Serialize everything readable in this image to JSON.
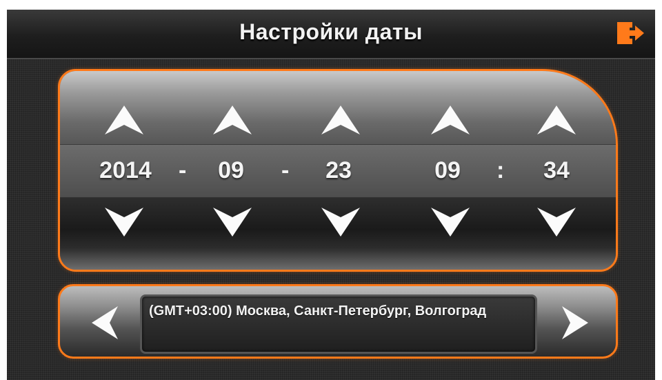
{
  "header": {
    "title": "Настройки даты",
    "exit_icon": "exit-icon",
    "accent_color": "#ff7a1a"
  },
  "date_time": {
    "year": "2014",
    "month": "09",
    "day": "23",
    "hour": "09",
    "minute": "34",
    "date_separator": "-",
    "time_separator": ":",
    "up_icon": "up-arrow-icon",
    "down_icon": "down-arrow-icon"
  },
  "timezone": {
    "value": "(GMT+03:00) Москва, Санкт-Петербург, Волгоград",
    "prev_icon": "left-arrow-icon",
    "next_icon": "right-arrow-icon"
  }
}
